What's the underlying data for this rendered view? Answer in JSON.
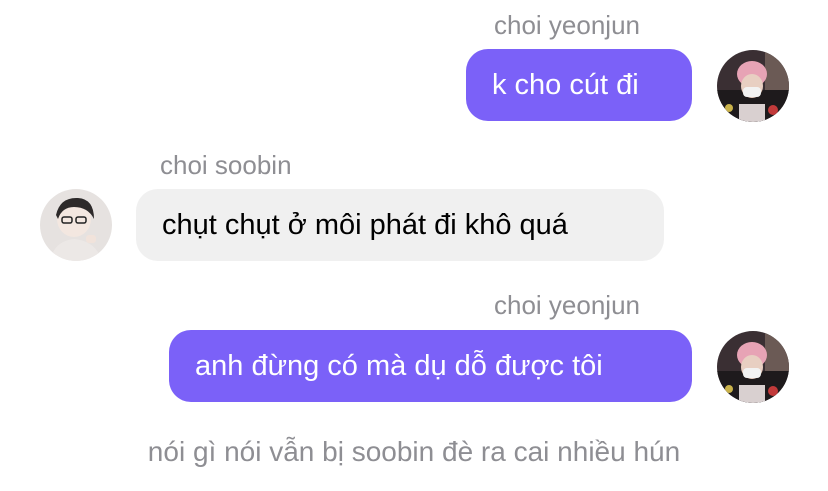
{
  "messages": [
    {
      "sender": "choi yeonjun",
      "text": "k cho cút đi",
      "direction": "outgoing",
      "avatar": "avatar-yeonjun"
    },
    {
      "sender": "choi soobin",
      "text": "chụt chụt ở môi phát đi khô quá",
      "direction": "incoming",
      "avatar": "avatar-soobin"
    },
    {
      "sender": "choi yeonjun",
      "text": "anh đừng có mà dụ dỗ được tôi",
      "direction": "outgoing",
      "avatar": "avatar-yeonjun"
    }
  ],
  "footer": {
    "note": "nói gì nói vẫn bị soobin đè ra cai nhiều hún"
  },
  "colors": {
    "outgoing_bubble": "#7b61f8",
    "incoming_bubble": "#f0f0f0",
    "sender_name": "#8e8e93"
  }
}
